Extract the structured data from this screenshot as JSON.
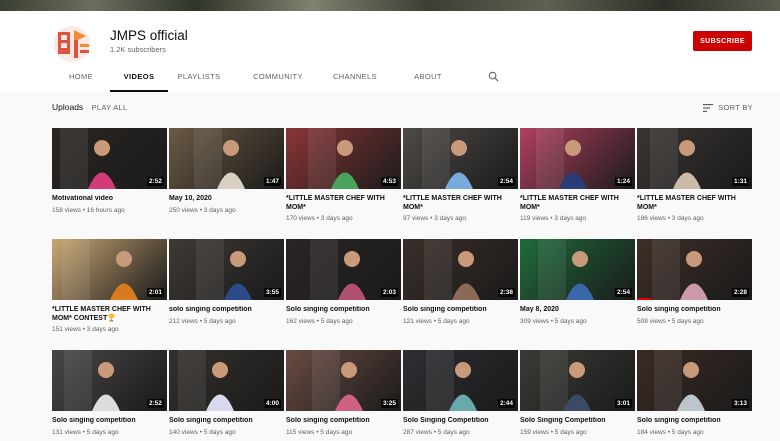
{
  "channel": {
    "name": "JMPS official",
    "subscribers": "1.2K subscribers",
    "subscribe_label": "SUBSCRIBE",
    "accent": "#cc0000"
  },
  "tabs": [
    {
      "label": "HOME",
      "active": false
    },
    {
      "label": "VIDEOS",
      "active": true
    },
    {
      "label": "PLAYLISTS",
      "active": false
    },
    {
      "label": "COMMUNITY",
      "active": false
    },
    {
      "label": "CHANNELS",
      "active": false
    },
    {
      "label": "ABOUT",
      "active": false
    }
  ],
  "search_icon": "search-icon",
  "uploads": {
    "title": "Uploads",
    "play_all": "PLAY ALL",
    "sort_by": "SORT BY"
  },
  "videos": [
    {
      "title": "Motivational video",
      "meta": "158 views • 16 hours ago",
      "duration": "2:52",
      "bg": "#2a2622",
      "accent": "#d23a7a"
    },
    {
      "title": "May 10, 2020",
      "meta": "250 views • 3 days ago",
      "duration": "1:47",
      "bg": "#6b5a44",
      "accent": "#d8d0c0"
    },
    {
      "title": "*LITTLE MASTER CHEF WITH MOM*",
      "meta": "170 views • 3 days ago",
      "duration": "4:53",
      "bg": "#8a3535",
      "accent": "#4aa35c"
    },
    {
      "title": "*LITTLE MASTER CHEF WITH MOM*",
      "meta": "97 views • 3 days ago",
      "duration": "2:54",
      "bg": "#4e4a46",
      "accent": "#77aadd"
    },
    {
      "title": "*LITTLE MASTER CHEF WITH MOM*",
      "meta": "119 views • 3 days ago",
      "duration": "1:24",
      "bg": "#b04060",
      "accent": "#2a3c77"
    },
    {
      "title": "*LITTLE MASTER CHEF WITH MOM*",
      "meta": "186 views • 3 days ago",
      "duration": "1:31",
      "bg": "#3a3532",
      "accent": "#ccbbaa"
    },
    {
      "title": "*LITTLE MASTER CHEF WITH MOM* CONTEST",
      "title_badge": "🏆",
      "meta": "151 views • 3 days ago",
      "duration": "2:01",
      "bg": "#c9a774",
      "accent": "#d87a20"
    },
    {
      "title": "solo singing competition",
      "meta": "212 views • 5 days ago",
      "duration": "3:55",
      "bg": "#3e3934",
      "accent": "#2c4a88"
    },
    {
      "title": "Solo singing competition",
      "meta": "162 views • 5 days ago",
      "duration": "2:03",
      "bg": "#2a2424",
      "accent": "#b05070"
    },
    {
      "title": "Solo singing competition",
      "meta": "121 views • 5 days ago",
      "duration": "2:38",
      "bg": "#3a2e28",
      "accent": "#8a6a55"
    },
    {
      "title": "May 8, 2020",
      "meta": "309 views • 5 days ago",
      "duration": "2:54",
      "bg": "#1f6b3a",
      "accent": "#3a66aa"
    },
    {
      "title": "Solo singing competition",
      "meta": "508 views • 5 days ago",
      "duration": "2:28",
      "bg": "#3e2e26",
      "accent": "#cc99aa",
      "progress": 0.12
    },
    {
      "title": "Solo singing competition",
      "meta": "131 views • 5 days ago",
      "duration": "2:52",
      "bg": "#4a4646",
      "accent": "#dcdcdc"
    },
    {
      "title": "Solo singing competition",
      "meta": "140 views • 5 days ago",
      "duration": "4:00",
      "bg": "#34302c",
      "accent": "#d8d8ee"
    },
    {
      "title": "Solo singing competition",
      "meta": "115 views • 5 days ago",
      "duration": "3:25",
      "bg": "#6a4a42",
      "accent": "#d06080"
    },
    {
      "title": "Solo Singing Competition",
      "meta": "287 views • 5 days ago",
      "duration": "2:44",
      "bg": "#2e2e33",
      "accent": "#66aaaa"
    },
    {
      "title": "Solo Singing Competition",
      "meta": "159 views • 5 days ago",
      "duration": "3:01",
      "bg": "#3a3a36",
      "accent": "#3c4a66"
    },
    {
      "title": "Solo singing competition",
      "meta": "184 views • 5 days ago",
      "duration": "3:13",
      "bg": "#3a2a24",
      "accent": "#bcc4cc"
    }
  ]
}
